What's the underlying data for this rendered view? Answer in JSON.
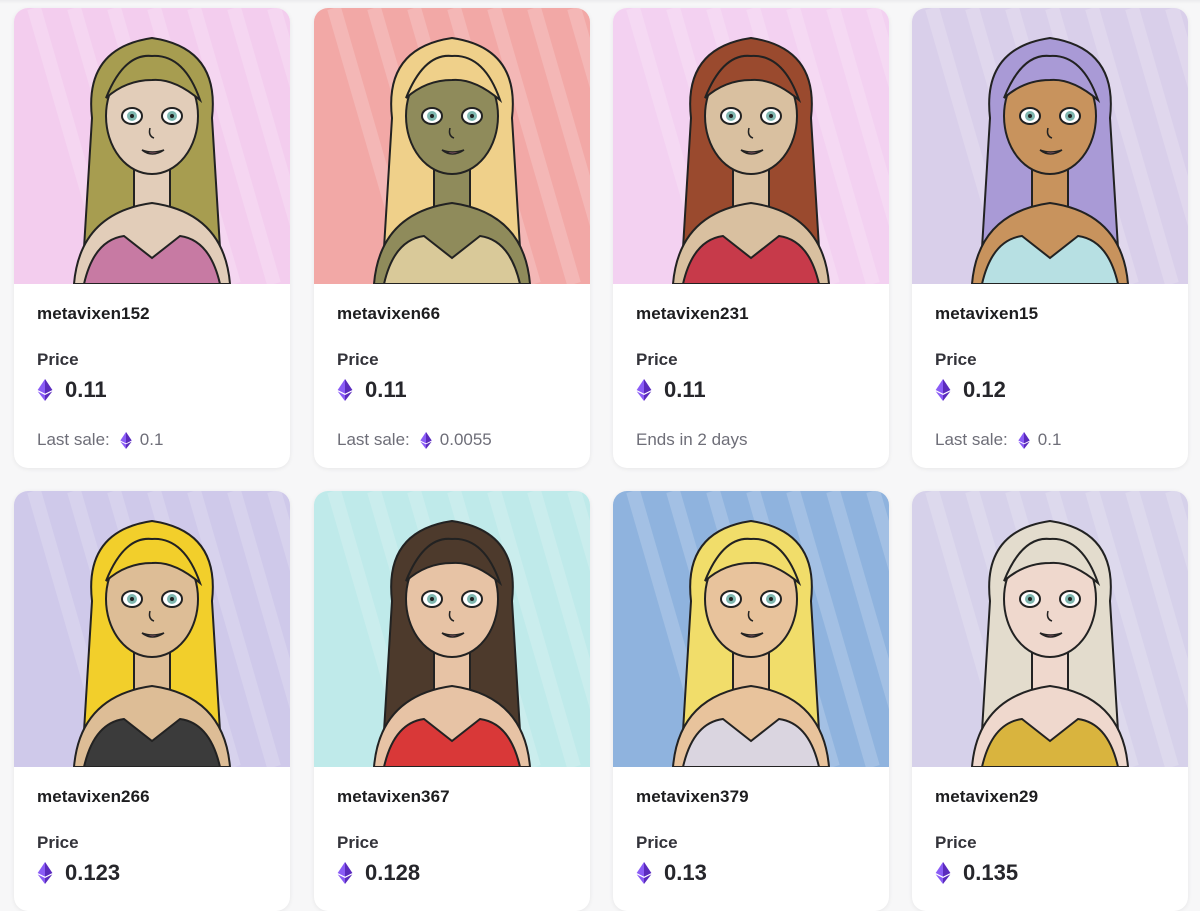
{
  "cards": [
    {
      "name": "metavixen152",
      "price_label": "Price",
      "price": "0.11",
      "footer": "Last sale:",
      "footer_value": "0.1",
      "bg": "#f3cdee",
      "skin": "#e2cdb9",
      "hair": "#a79d50",
      "outfit": "#c77aa3",
      "has_eth_footer": true
    },
    {
      "name": "metavixen66",
      "price_label": "Price",
      "price": "0.11",
      "footer": "Last sale:",
      "footer_value": "0.0055",
      "bg": "#f2a8a6",
      "skin": "#8f8b5b",
      "hair": "#efd08a",
      "outfit": "#d9c999",
      "has_eth_footer": true
    },
    {
      "name": "metavixen231",
      "price_label": "Price",
      "price": "0.11",
      "footer": "Ends in 2 days",
      "footer_value": "",
      "bg": "#f3d1f1",
      "skin": "#d9c0a0",
      "hair": "#9a4a2e",
      "outfit": "#c73a4a",
      "has_eth_footer": false
    },
    {
      "name": "metavixen15",
      "price_label": "Price",
      "price": "0.12",
      "footer": "Last sale:",
      "footer_value": "0.1",
      "bg": "#d9cfea",
      "skin": "#c8935d",
      "hair": "#a99ad6",
      "outfit": "#b7e0e3",
      "has_eth_footer": true
    },
    {
      "name": "metavixen266",
      "price_label": "Price",
      "price": "0.123",
      "footer": "",
      "footer_value": "",
      "bg": "#cfc9ea",
      "skin": "#ddbd96",
      "hair": "#f2cf2b",
      "outfit": "#3b3b3b",
      "has_eth_footer": false
    },
    {
      "name": "metavixen367",
      "price_label": "Price",
      "price": "0.128",
      "footer": "",
      "footer_value": "",
      "bg": "#bfeaea",
      "skin": "#e7c3a5",
      "hair": "#4d3a2c",
      "outfit": "#d93838",
      "has_eth_footer": false
    },
    {
      "name": "metavixen379",
      "price_label": "Price",
      "price": "0.13",
      "footer": "",
      "footer_value": "",
      "bg": "#8fb3de",
      "skin": "#e8c39c",
      "hair": "#f1dd6a",
      "outfit": "#dad5e0",
      "has_eth_footer": false
    },
    {
      "name": "metavixen29",
      "price_label": "Price",
      "price": "0.135",
      "footer": "",
      "footer_value": "",
      "bg": "#d6d1ea",
      "skin": "#efd8cd",
      "hair": "#e3dccd",
      "outfit": "#d9b43e",
      "has_eth_footer": false
    }
  ],
  "icons": {
    "currency": "ethereum-icon"
  },
  "colors": {
    "eth_light": "#8a5cf6",
    "eth_dark": "#5b2bbd"
  }
}
